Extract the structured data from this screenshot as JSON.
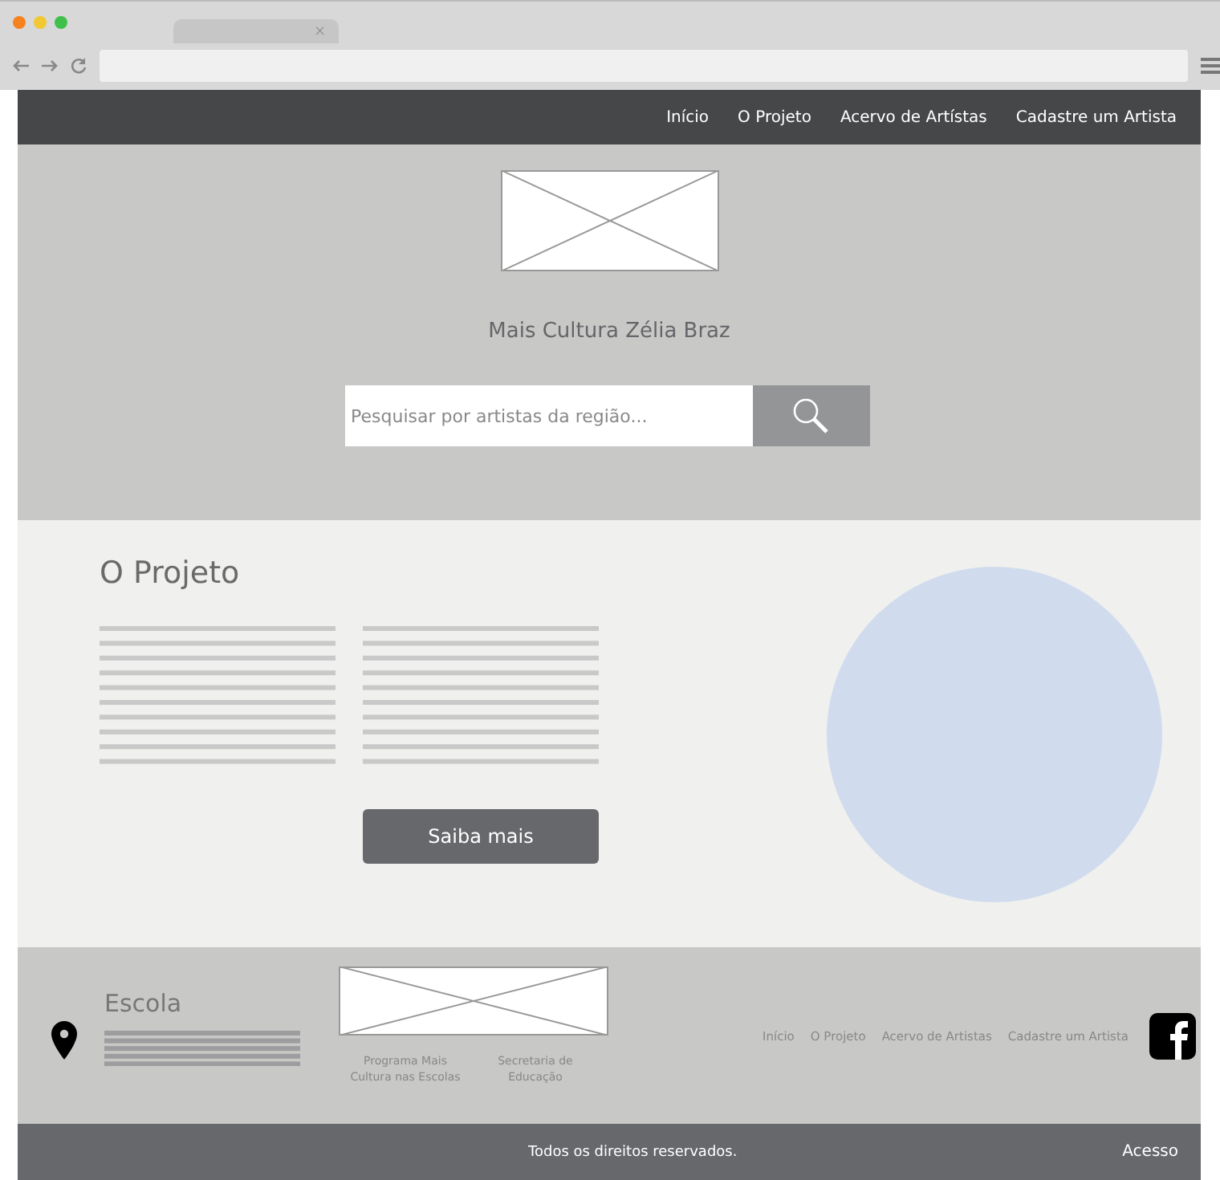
{
  "browser": {
    "tab_close": "×"
  },
  "nav": {
    "links": [
      "Início",
      "O Projeto",
      "Acervo de Artístas",
      "Cadastre um Artista"
    ]
  },
  "hero": {
    "title": "Mais Cultura Zélia Braz",
    "search": {
      "placeholder": "Pesquisar por artistas da região..."
    }
  },
  "project": {
    "heading": "O Projeto",
    "button": "Saiba mais"
  },
  "footer": {
    "school": "Escola",
    "captions": [
      "Programa Mais Cultura nas Escolas",
      "Secretaria de Educação"
    ],
    "links": [
      "Início",
      "O Projeto",
      "Acervo de Artistas",
      "Cadastre um Artista"
    ]
  },
  "bottom_bar": {
    "text": "Todos os direitos reservados.",
    "link": "Acesso"
  }
}
